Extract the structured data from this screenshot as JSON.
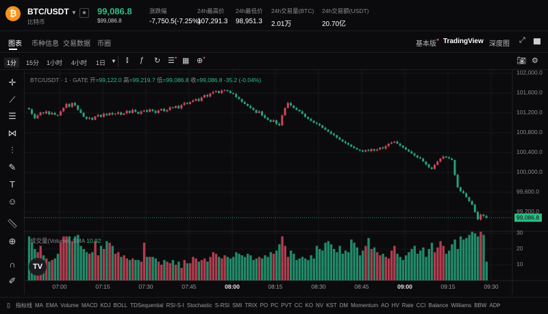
{
  "header": {
    "logo_glyph": "₿",
    "symbol": "BTC/USDT",
    "name": "比特币",
    "price": "99,086.8",
    "price_usd": "$99,086.8",
    "stats": [
      {
        "label": "涨跌幅",
        "value": "-7,750.5(-7.25%)",
        "green": true
      },
      {
        "label": "24h最高价",
        "value": "107,291.3"
      },
      {
        "label": "24h最低价",
        "value": "98,951.3"
      },
      {
        "label": "24h交易量(BTC)",
        "value": "2.01万"
      },
      {
        "label": "24h交易额(USDT)",
        "value": "20.70亿"
      }
    ]
  },
  "tabs": [
    "图表",
    "币种信息",
    "交易数据",
    "币圈"
  ],
  "views": {
    "basic": "基本版",
    "tradingview": "TradingView",
    "depth": "深度图"
  },
  "timeframes": [
    "1分",
    "15分",
    "1小时",
    "4小时",
    "1日"
  ],
  "legend": {
    "title": "BTC/USDT · 1 · GATE",
    "o_label": "开",
    "o": "=99,122.0",
    "h_label": "高",
    "h": "=99,219.7",
    "l_label": "低",
    "l": "=99,086.8",
    "c_label": "收",
    "c": "=99,086.8",
    "change": "-35.2 (-0.04%)"
  },
  "volume_legend": {
    "title": "成交量(Volume) SMA",
    "value": "10.92"
  },
  "indicators_label": "指标线",
  "indicators": [
    "MA",
    "EMA",
    "Volume",
    "MACD",
    "KDJ",
    "BOLL",
    "TDSequential",
    "RSI-S-I",
    "Stochastic",
    "S-RSI",
    "SMI",
    "TRIX",
    "PO",
    "PC",
    "PVT",
    "CC",
    "KO",
    "NV",
    "KST",
    "DM",
    "Momentum",
    "AO",
    "HV",
    "Rate",
    "CCI",
    "Balance",
    "Williams",
    "BBW",
    "ADI"
  ],
  "colors": {
    "up": "#d2445b",
    "down": "#26a17a",
    "accent_green": "#2ebd85",
    "logo": "#f7931a"
  },
  "chart_data": {
    "type": "candlestick",
    "price_ticks": [
      "102,000.0",
      "101,600.0",
      "101,200.0",
      "100,800.0",
      "100,400.0",
      "100,000.0",
      "99,600.0",
      "99,200.0"
    ],
    "last_price_label": "99,086.8",
    "volume_ticks": [
      "30",
      "20",
      "10"
    ],
    "time_ticks": [
      {
        "t": "07:00",
        "bold": false
      },
      {
        "t": "07:15",
        "bold": false
      },
      {
        "t": "07:30",
        "bold": false
      },
      {
        "t": "07:45",
        "bold": false
      },
      {
        "t": "08:00",
        "bold": true
      },
      {
        "t": "08:15",
        "bold": false
      },
      {
        "t": "08:30",
        "bold": false
      },
      {
        "t": "08:45",
        "bold": false
      },
      {
        "t": "09:00",
        "bold": true
      },
      {
        "t": "09:15",
        "bold": false
      },
      {
        "t": "09:30",
        "bold": false
      }
    ],
    "interval": "1m",
    "start_time": "06:49",
    "first_open": 101300,
    "closes": [
      101270,
      101180,
      101090,
      101150,
      101210,
      101190,
      101230,
      101170,
      101200,
      101160,
      101150,
      101230,
      101300,
      101380,
      101320,
      101400,
      101350,
      101260,
      101200,
      101120,
      101080,
      101100,
      101060,
      101130,
      101160,
      101120,
      101180,
      101150,
      101200,
      101170,
      101180,
      101210,
      101160,
      101190,
      101240,
      101200,
      101260,
      101220,
      101180,
      101230,
      101250,
      101220,
      101270,
      101240,
      101200,
      101250,
      101280,
      101230,
      101260,
      101310,
      101300,
      101340,
      101290,
      101360,
      101400,
      101380,
      101420,
      101450,
      101480,
      101440,
      101510,
      101560,
      101530,
      101590,
      101620,
      101640,
      101600,
      101650,
      101660,
      101640,
      101600,
      101580,
      101520,
      101480,
      101420,
      101380,
      101340,
      101300,
      101260,
      101200,
      101230,
      101150,
      101100,
      101060,
      101020,
      101050,
      100980,
      100950,
      101150,
      101300,
      101400,
      101350,
      101300,
      101260,
      101230,
      101180,
      101120,
      101080,
      101040,
      101000,
      100980,
      100950,
      100900,
      100860,
      100820,
      100780,
      100750,
      100700,
      100660,
      100620,
      100590,
      100560,
      100520,
      100490,
      100460,
      100440,
      100420,
      100450,
      100430,
      100470,
      100440,
      100460,
      100500,
      100480,
      100530,
      100580,
      100600,
      100620,
      100580,
      100540,
      100500,
      100460,
      100420,
      100380,
      100340,
      100300,
      100280,
      100220,
      100160,
      100100,
      100070,
      100150,
      100220,
      100280,
      100320,
      100300,
      100280,
      100250,
      99950,
      99700,
      99620,
      99580,
      99500,
      99420,
      99350,
      99200,
      99050,
      99150,
      99122,
      99086.8
    ],
    "volumes": [
      28,
      24,
      20,
      18,
      22,
      16,
      14,
      12,
      13,
      14,
      17,
      24,
      28,
      28,
      28,
      25,
      28,
      29,
      22,
      20,
      18,
      17,
      18,
      25,
      16,
      22,
      20,
      25,
      24,
      22,
      17,
      18,
      15,
      16,
      14,
      13,
      14,
      13,
      13,
      12,
      24,
      15,
      15,
      15,
      14,
      12,
      10,
      13,
      12,
      11,
      13,
      10,
      12,
      8,
      13,
      11,
      11,
      15,
      14,
      12,
      13,
      14,
      12,
      15,
      18,
      17,
      15,
      14,
      16,
      15,
      14,
      15,
      18,
      17,
      16,
      15,
      17,
      16,
      13,
      14,
      15,
      14,
      16,
      15,
      18,
      17,
      19,
      23,
      28,
      22,
      15,
      19,
      17,
      13,
      14,
      15,
      14,
      13,
      16,
      14,
      22,
      20,
      19,
      24,
      25,
      23,
      20,
      18,
      22,
      17,
      19,
      18,
      26,
      24,
      21,
      16,
      19,
      22,
      27,
      20,
      21,
      18,
      16,
      17,
      15,
      14,
      19,
      22,
      17,
      15,
      13,
      16,
      18,
      20,
      22,
      17,
      19,
      21,
      15,
      20,
      24,
      18,
      21,
      25,
      22,
      17,
      19,
      23,
      26,
      20,
      28,
      26,
      27,
      29,
      31,
      30,
      28,
      31,
      29,
      12
    ]
  }
}
